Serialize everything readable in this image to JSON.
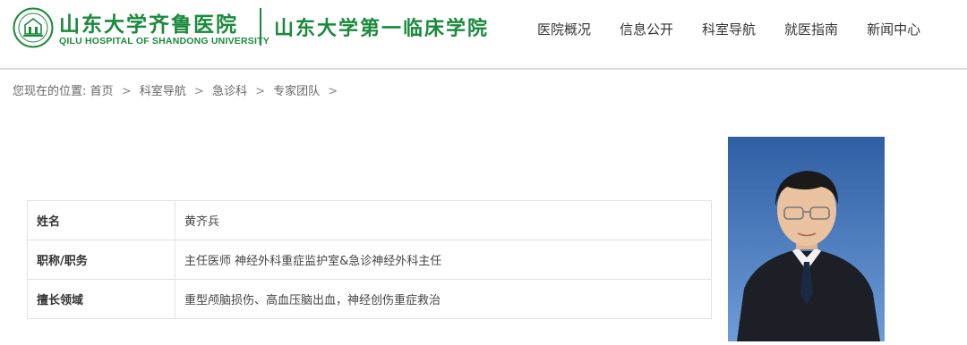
{
  "header": {
    "logo_cn": "山东大学齐鲁医院",
    "logo_en": "QILU HOSPITAL OF SHANDONG UNIVERSITY",
    "logo_sub": "山东大学第一临床学院",
    "seal_icon": "hospital-seal-icon",
    "brand_color": "#1a8a3b"
  },
  "nav": {
    "items": [
      {
        "label": "医院概况"
      },
      {
        "label": "信息公开"
      },
      {
        "label": "科室导航"
      },
      {
        "label": "就医指南"
      },
      {
        "label": "新闻中心"
      }
    ]
  },
  "breadcrumb": {
    "prefix": "您现在的位置:",
    "items": [
      {
        "label": "首页"
      },
      {
        "label": "科室导航"
      },
      {
        "label": "急诊科"
      },
      {
        "label": "专家团队"
      }
    ],
    "separator": ">"
  },
  "profile": {
    "rows": [
      {
        "label": "姓名",
        "value": "黄齐兵"
      },
      {
        "label": "职称/职务",
        "value": "主任医师 神经外科重症监护室&急诊神经外科主任"
      },
      {
        "label": "擅长领域",
        "value": "重型颅脑损伤、高血压脑出血，神经创伤重症救治"
      }
    ]
  }
}
